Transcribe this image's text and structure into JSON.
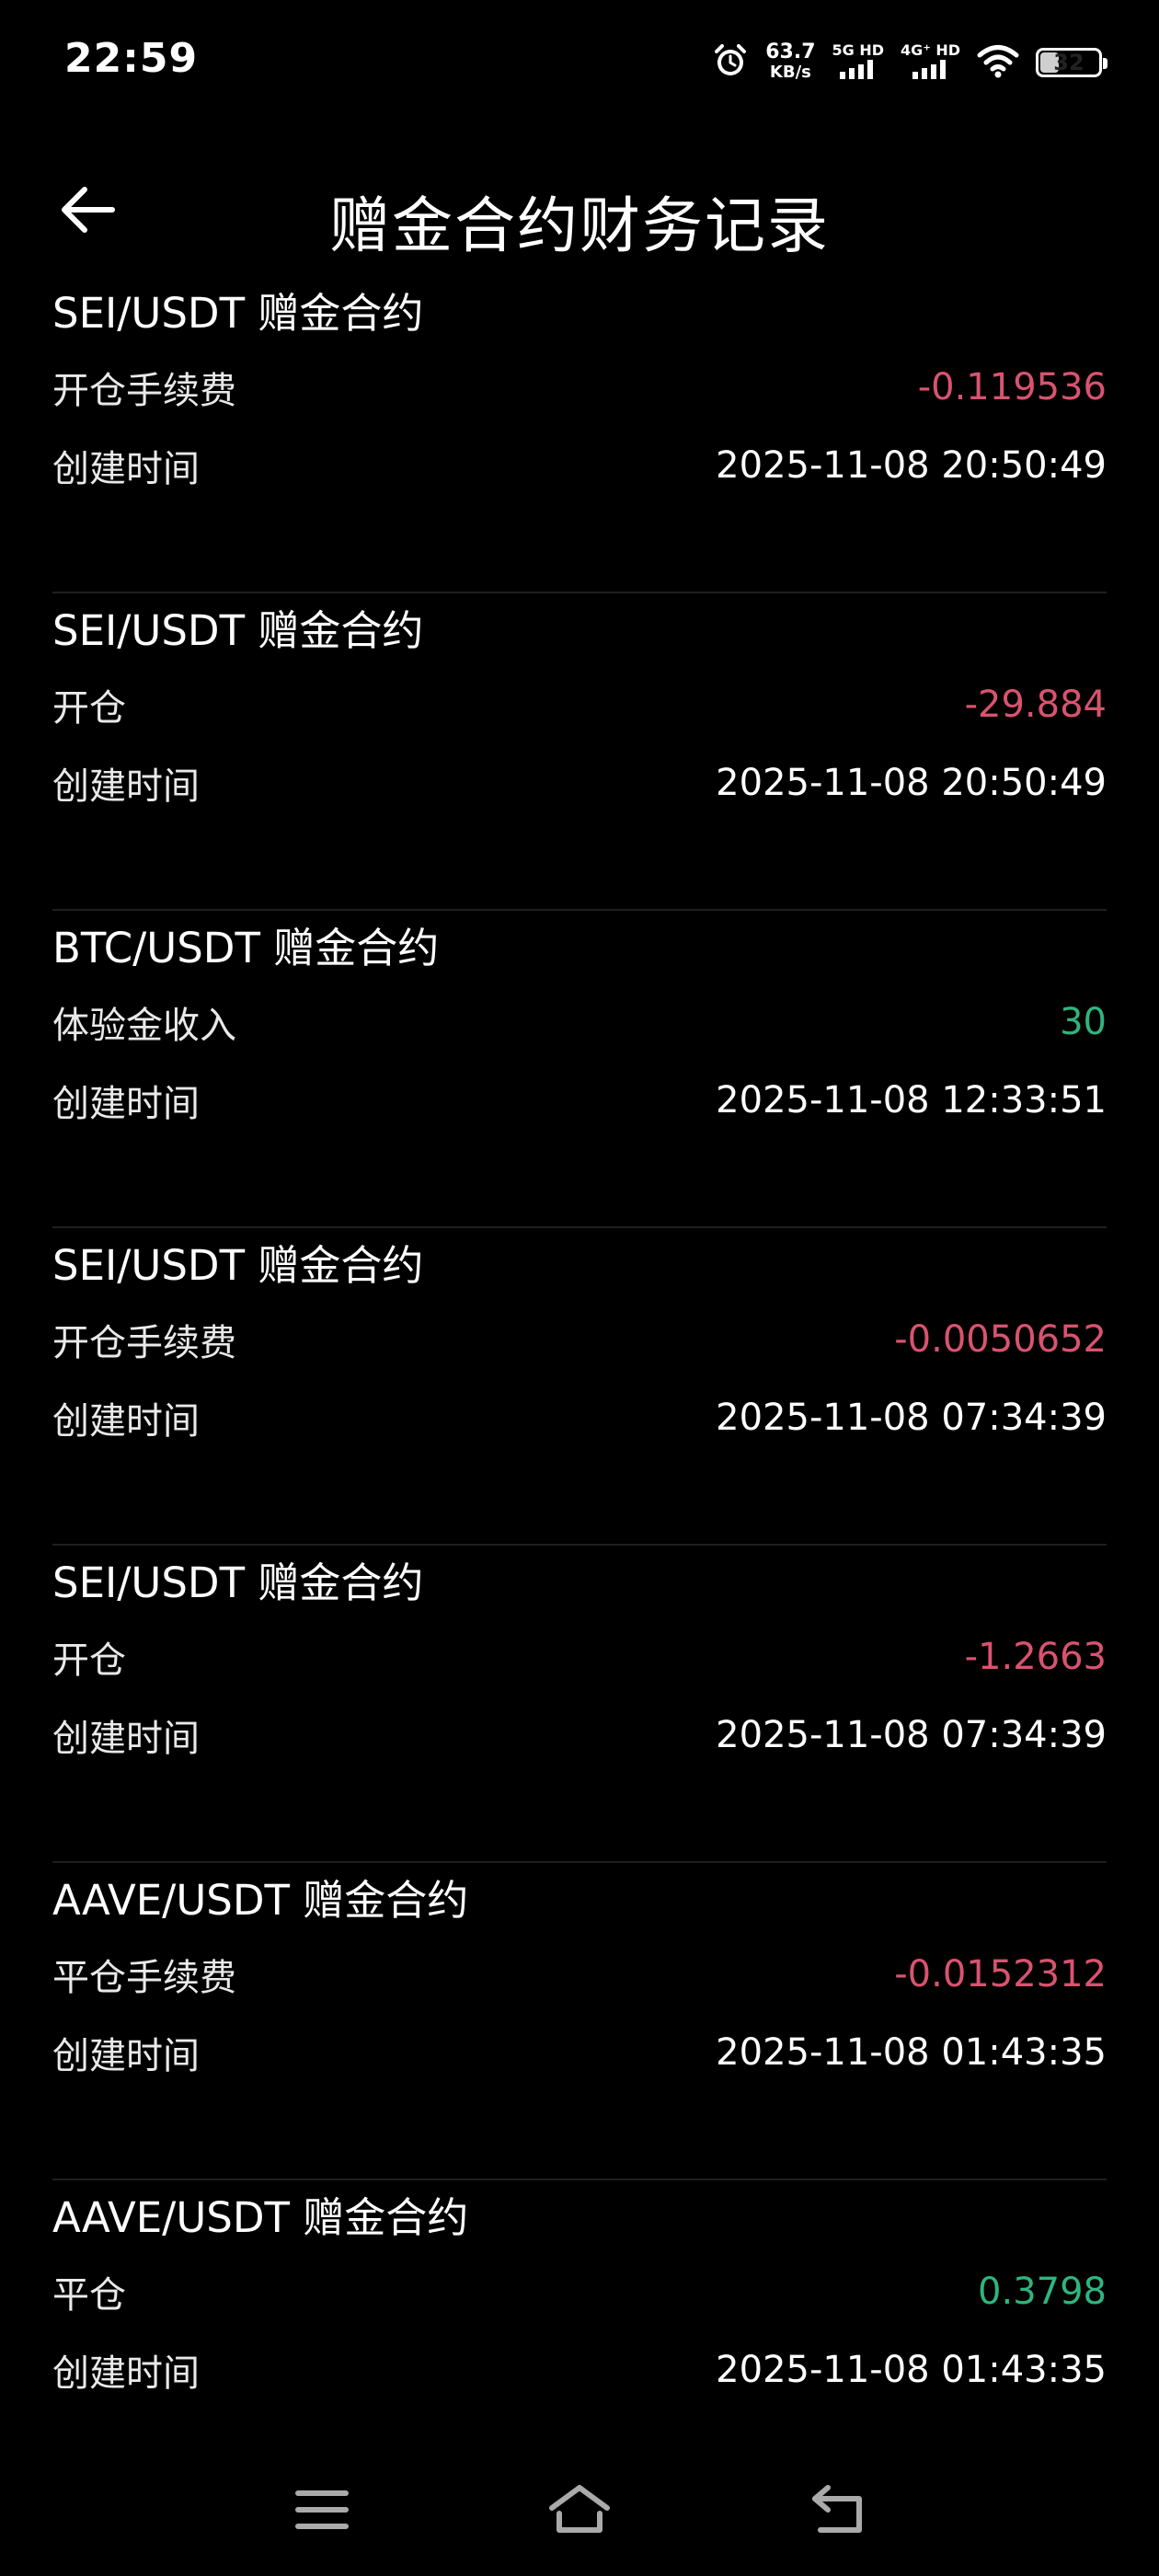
{
  "status_bar": {
    "time": "22:59",
    "net_speed": "63.7",
    "net_speed_unit": "KB/s",
    "sim1_label": "5G HD",
    "sim2_label": "4G⁺ HD",
    "battery_level": "32",
    "icons": [
      "alarm-icon",
      "signal-icon",
      "signal-icon",
      "wifi-icon",
      "battery-icon"
    ]
  },
  "header": {
    "title": "赠金合约财务记录",
    "back_icon": "arrow-left-icon"
  },
  "records": [
    {
      "title": "SEI/USDT 赠金合约",
      "type": "开仓手续费",
      "amount": "-0.119536",
      "time_label": "创建时间",
      "time": "2025-11-08 20:50:49"
    },
    {
      "title": "SEI/USDT 赠金合约",
      "type": "开仓",
      "amount": "-29.884",
      "time_label": "创建时间",
      "time": "2025-11-08 20:50:49"
    },
    {
      "title": "BTC/USDT 赠金合约",
      "type": "体验金收入",
      "amount": "30",
      "time_label": "创建时间",
      "time": "2025-11-08 12:33:51"
    },
    {
      "title": "SEI/USDT 赠金合约",
      "type": "开仓手续费",
      "amount": "-0.0050652",
      "time_label": "创建时间",
      "time": "2025-11-08 07:34:39"
    },
    {
      "title": "SEI/USDT 赠金合约",
      "type": "开仓",
      "amount": "-1.2663",
      "time_label": "创建时间",
      "time": "2025-11-08 07:34:39"
    },
    {
      "title": "AAVE/USDT 赠金合约",
      "type": "平仓手续费",
      "amount": "-0.0152312",
      "time_label": "创建时间",
      "time": "2025-11-08 01:43:35"
    },
    {
      "title": "AAVE/USDT 赠金合约",
      "type": "平仓",
      "amount": "0.3798",
      "time_label": "创建时间",
      "time": "2025-11-08 01:43:35"
    }
  ],
  "colors": {
    "negative": "#d9536f",
    "positive": "#2fb57e",
    "background": "#000000"
  },
  "nav_bar": {
    "icons": [
      "menu-icon",
      "home-icon",
      "back-icon"
    ]
  }
}
